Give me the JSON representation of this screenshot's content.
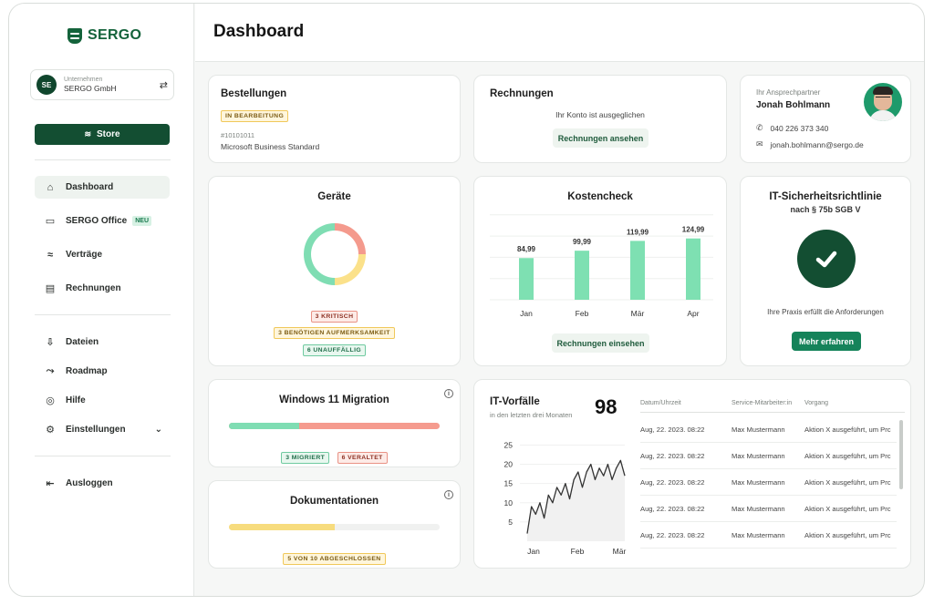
{
  "brand": {
    "name": "SERGO",
    "accent": "#134e32"
  },
  "company": {
    "initials": "SE",
    "label": "Unternehmen",
    "name": "SERGO GmbH"
  },
  "store": {
    "label": "Store"
  },
  "nav": {
    "dashboard": "Dashboard",
    "office": "SERGO Office",
    "office_badge": "NEU",
    "contracts": "Verträge",
    "invoices": "Rechnungen",
    "files": "Dateien",
    "roadmap": "Roadmap",
    "help": "Hilfe",
    "settings": "Einstellungen",
    "logout": "Ausloggen"
  },
  "page": {
    "title": "Dashboard"
  },
  "orders": {
    "title": "Bestellungen",
    "status": "IN BEARBEITUNG",
    "number": "#10101011",
    "product": "Microsoft Business Standard"
  },
  "invoices_card": {
    "title": "Rechnungen",
    "message": "Ihr Konto ist ausgeglichen",
    "button": "Rechnungen ansehen"
  },
  "contact": {
    "label": "Ihr Ansprechpartner",
    "name": "Jonah Bohlmann",
    "phone": "040 226 373 340",
    "email": "jonah.bohlmann@sergo.de"
  },
  "devices": {
    "title": "Geräte",
    "critical": "3 KRITISCH",
    "attention": "3 BENÖTIGEN AUFMERKSAMKEIT",
    "ok": "6 UNAUFFÄLLIG",
    "counts": {
      "critical": 3,
      "attention": 3,
      "ok": 6
    }
  },
  "costs": {
    "title": "Kostencheck",
    "button": "Rechnungen einsehen"
  },
  "security": {
    "title": "IT-Sicherheitsrichtlinie",
    "subtitle": "nach § 75b SGB V",
    "message": "Ihre Praxis erfüllt die Anforderungen",
    "button": "Mehr erfahren"
  },
  "migration": {
    "title": "Windows 11 Migration",
    "migrated": "3 MIGRIERT",
    "outdated": "6 VERALTET",
    "migrated_fraction": 0.333
  },
  "docs": {
    "title": "Dokumentationen",
    "status": "5 VON 10 ABGESCHLOSSEN",
    "completed_fraction": 0.5
  },
  "incidents": {
    "title": "IT-Vorfälle",
    "subtitle": "in den letzten drei Monaten",
    "count": "98",
    "table": {
      "headers": [
        "Datum/Uhrzeit",
        "Service-Mitarbeiter:in",
        "Vorgang"
      ],
      "rows": [
        [
          "Aug, 22. 2023. 08:22",
          "Max Mustermann",
          "Aktion X ausgeführt, um Prc"
        ],
        [
          "Aug, 22. 2023. 08:22",
          "Max Mustermann",
          "Aktion X ausgeführt, um Prc"
        ],
        [
          "Aug, 22. 2023. 08:22",
          "Max Mustermann",
          "Aktion X ausgeführt, um Prc"
        ],
        [
          "Aug, 22. 2023. 08:22",
          "Max Mustermann",
          "Aktion X ausgeführt, um Prc"
        ],
        [
          "Aug, 22. 2023. 08:22",
          "Max Mustermann",
          "Aktion X ausgeführt, um Prc"
        ]
      ]
    }
  },
  "chart_data": [
    {
      "type": "bar",
      "categories": [
        "Jan",
        "Feb",
        "Mär",
        "Apr"
      ],
      "values": [
        84.99,
        99.99,
        119.99,
        124.99
      ],
      "value_labels": [
        "84,99",
        "99,99",
        "119,99",
        "124,99"
      ],
      "color": "#7ee0b2",
      "grid": true
    },
    {
      "type": "line",
      "x_ticks": [
        "Jan",
        "Feb",
        "Mär"
      ],
      "y_ticks": [
        "25",
        "20",
        "15",
        "10",
        "5"
      ],
      "ylim": [
        0,
        27
      ],
      "values": [
        2,
        9,
        7,
        10,
        6,
        12,
        10,
        14,
        12,
        15,
        11,
        16,
        18,
        14,
        18,
        20,
        16,
        19,
        17,
        20,
        16,
        19,
        21,
        17
      ],
      "color": "#333333"
    }
  ]
}
